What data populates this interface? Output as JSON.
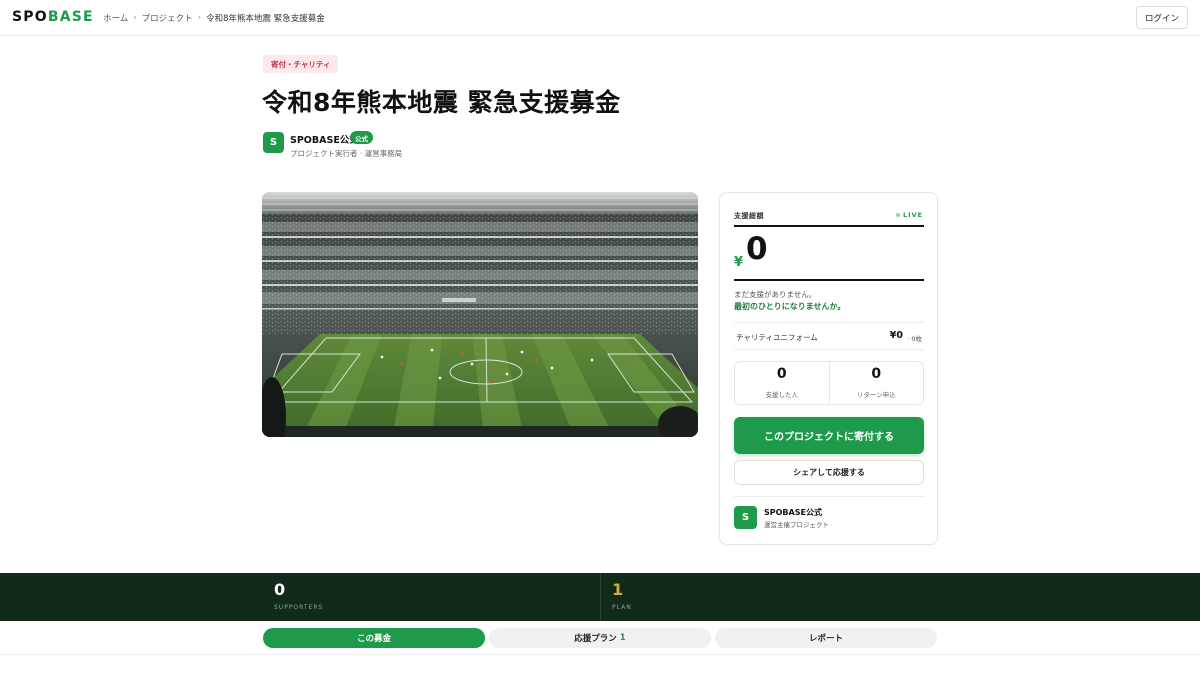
{
  "header": {
    "logo_main": "SPO",
    "logo_accent": "BASE",
    "breadcrumb": [
      "ホーム",
      "プロジェクト",
      "令和8年熊本地震 緊急支援募金"
    ],
    "login_label": "ログイン"
  },
  "project": {
    "category": "寄付・チャリティ",
    "title": "令和8年熊本地震 緊急支援募金",
    "org_initial": "S",
    "org_name": "SPOBASE公式",
    "official_label": "公式",
    "org_role": "プロジェクト実行者 · 運営事務局"
  },
  "funding": {
    "label": "支援総額",
    "live_label": "LIVE",
    "currency": "¥",
    "amount": "0",
    "no_support_text": "まだ支援がありません。",
    "cta_text": "最初のひとりになりませんか。",
    "reward_name": "チャリティユニフォーム",
    "reward_amount": "¥0",
    "reward_count": "· 0枚",
    "supporters_count": "0",
    "supporters_label": "支援した人",
    "returns_count": "0",
    "returns_label": "リターン申込",
    "donate_label": "このプロジェクトに寄付する",
    "share_label": "シェアして応援する",
    "org_initial": "S",
    "org_name": "SPOBASE公式",
    "org_sub": "運営主催プロジェクト"
  },
  "stats_bar": {
    "supporters_num": "0",
    "supporters_label": "SUPPORTERS",
    "plan_num": "1",
    "plan_label": "PLAN"
  },
  "tabs": {
    "about": "この募金",
    "plans": "応援プラン",
    "plans_count": "1",
    "report": "レポート"
  },
  "colors": {
    "brand_green": "#1f9a4b",
    "dark_bar": "#112a1a",
    "plan_number": "#d4a943"
  }
}
